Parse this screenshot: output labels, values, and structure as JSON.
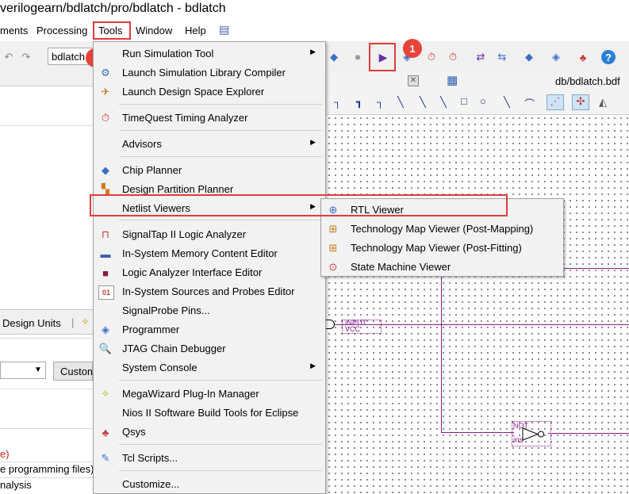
{
  "window": {
    "title": "verilogearn/bdlatch/pro/bdlatch - bdlatch"
  },
  "menubar": {
    "items": [
      "ments",
      "Processing",
      "Tools",
      "Window",
      "Help"
    ]
  },
  "toolbar": {
    "project_combo": "bdlatch",
    "badge1": "1",
    "badge2": "2"
  },
  "editor": {
    "tab_path": "db/bdlatch.bdf"
  },
  "left_panel": {
    "design_units_tab": "Design Units",
    "custom_button": "Custom",
    "msg1": "e)",
    "msg2": "e programming files)",
    "msg3": "nalysis"
  },
  "tools_menu": {
    "items": [
      {
        "label": "Run Simulation Tool",
        "submenu": true,
        "icon": "simulation-icon"
      },
      {
        "label": "Launch Simulation Library Compiler",
        "submenu": false,
        "icon": "library-compiler-icon"
      },
      {
        "label": "Launch Design Space Explorer",
        "submenu": false,
        "icon": "dse-icon"
      },
      {
        "label": "TimeQuest Timing Analyzer",
        "submenu": false,
        "icon": "stopwatch-icon"
      },
      {
        "label": "Advisors",
        "submenu": true,
        "icon": ""
      },
      {
        "label": "Chip Planner",
        "submenu": false,
        "icon": "chip-planner-icon"
      },
      {
        "label": "Design Partition Planner",
        "submenu": false,
        "icon": "partition-icon"
      },
      {
        "label": "Netlist Viewers",
        "submenu": true,
        "icon": ""
      },
      {
        "label": "SignalTap II Logic Analyzer",
        "submenu": false,
        "icon": "signaltap-icon"
      },
      {
        "label": "In-System Memory Content Editor",
        "submenu": false,
        "icon": "memory-icon"
      },
      {
        "label": "Logic Analyzer Interface Editor",
        "submenu": false,
        "icon": "lai-icon"
      },
      {
        "label": "In-System Sources and Probes Editor",
        "submenu": false,
        "icon": "sources-probes-icon"
      },
      {
        "label": "SignalProbe Pins...",
        "submenu": false,
        "icon": ""
      },
      {
        "label": "Programmer",
        "submenu": false,
        "icon": "programmer-icon"
      },
      {
        "label": "JTAG Chain Debugger",
        "submenu": false,
        "icon": "jtag-icon"
      },
      {
        "label": "System Console",
        "submenu": true,
        "icon": ""
      },
      {
        "label": "MegaWizard Plug-In Manager",
        "submenu": false,
        "icon": "wand-icon"
      },
      {
        "label": "Nios II Software Build Tools for Eclipse",
        "submenu": false,
        "icon": ""
      },
      {
        "label": "Qsys",
        "submenu": false,
        "icon": "qsys-icon"
      },
      {
        "label": "Tcl Scripts...",
        "submenu": false,
        "icon": "tcl-icon"
      },
      {
        "label": "Customize...",
        "submenu": false,
        "icon": ""
      }
    ]
  },
  "netlist_submenu": {
    "items": [
      {
        "label": "RTL Viewer",
        "icon": "rtl-viewer-icon"
      },
      {
        "label": "Technology Map Viewer (Post-Mapping)",
        "icon": "techmap-icon"
      },
      {
        "label": "Technology Map Viewer (Post-Fitting)",
        "icon": "techmap-icon"
      },
      {
        "label": "State Machine Viewer",
        "icon": "state-machine-icon"
      }
    ]
  },
  "schematic": {
    "input_label": "INPUT",
    "input_value": "VCC",
    "not_label": "NOT",
    "inst_label": "ins"
  }
}
